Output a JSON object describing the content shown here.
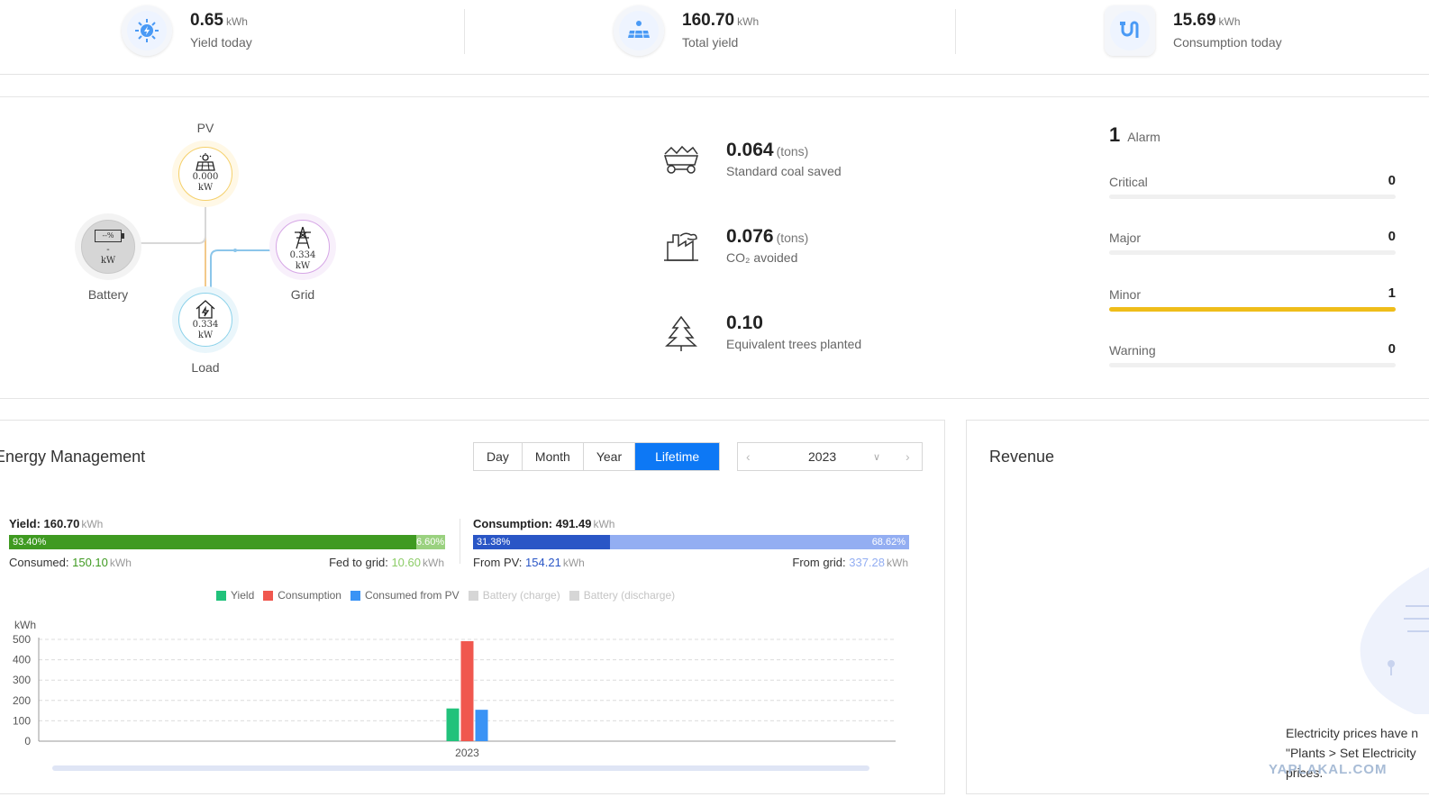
{
  "top_stats": [
    {
      "value": "0.65",
      "unit": "kWh",
      "label": "Yield today",
      "icon": "sun-bolt-icon"
    },
    {
      "value": "160.70",
      "unit": "kWh",
      "label": "Total yield",
      "icon": "solar-panel-icon"
    },
    {
      "value": "15.69",
      "unit": "kWh",
      "label": "Consumption today",
      "icon": "plug-icon"
    }
  ],
  "flow": {
    "pv": {
      "label": "PV",
      "value": "0.000",
      "unit": "kW",
      "icon": "solar-panel-icon"
    },
    "battery": {
      "label": "Battery",
      "soc": "--%",
      "value": "-",
      "unit": "kW",
      "icon": "battery-icon"
    },
    "grid": {
      "label": "Grid",
      "value": "0.334",
      "unit": "kW",
      "icon": "power-tower-icon"
    },
    "load": {
      "label": "Load",
      "value": "0.334",
      "unit": "kW",
      "icon": "house-icon"
    }
  },
  "environment": [
    {
      "value": "0.064",
      "unit": "(tons)",
      "label": "Standard coal saved",
      "icon": "coal-cart-icon"
    },
    {
      "value": "0.076",
      "unit": "(tons)",
      "label": "CO₂ avoided",
      "icon": "factory-icon"
    },
    {
      "value": "0.10",
      "unit": "",
      "label": "Equivalent trees planted",
      "icon": "tree-icon"
    }
  ],
  "alarms": {
    "count": "1",
    "title": "Alarm",
    "rows": [
      {
        "name": "Critical",
        "count": "0",
        "level": 0
      },
      {
        "name": "Major",
        "count": "0",
        "level": 0
      },
      {
        "name": "Minor",
        "count": "1",
        "level": 1
      },
      {
        "name": "Warning",
        "count": "0",
        "level": 0
      }
    ],
    "accent": "#efbd1a"
  },
  "energy": {
    "title": "Energy Management",
    "tabs": [
      "Day",
      "Month",
      "Year",
      "Lifetime"
    ],
    "active_tab": "Lifetime",
    "date": "2023",
    "yield": {
      "label": "Yield:",
      "value": "160.70",
      "unit": "kWh",
      "consumed_pct": "93.40%",
      "fed_pct": "6.60%",
      "consumed_label": "Consumed:",
      "consumed_value": "150.10",
      "fed_label": "Fed to grid:",
      "fed_value": "10.60",
      "unit2": "kWh"
    },
    "consumption": {
      "label": "Consumption:",
      "value": "491.49",
      "unit": "kWh",
      "pv_pct": "31.38%",
      "grid_pct": "68.62%",
      "pv_label": "From PV:",
      "pv_value": "154.21",
      "grid_label": "From grid:",
      "grid_value": "337.28",
      "unit2": "kWh"
    },
    "legend": [
      {
        "name": "Yield",
        "color": "#21c27b",
        "active": true
      },
      {
        "name": "Consumption",
        "color": "#f0574e",
        "active": true
      },
      {
        "name": "Consumed from PV",
        "color": "#3a93f5",
        "active": true
      },
      {
        "name": "Battery (charge)",
        "color": "#d6d6d6",
        "active": false
      },
      {
        "name": "Battery (discharge)",
        "color": "#d6d6d6",
        "active": false
      }
    ]
  },
  "chart_data": {
    "type": "bar",
    "ylabel": "kWh",
    "ylim": [
      0,
      500
    ],
    "yticks": [
      0,
      100,
      200,
      300,
      400,
      500
    ],
    "categories": [
      "2023"
    ],
    "series": [
      {
        "name": "Yield",
        "values": [
          160.7
        ],
        "color": "#21c27b"
      },
      {
        "name": "Consumption",
        "values": [
          491.49
        ],
        "color": "#f0574e"
      },
      {
        "name": "Consumed from PV",
        "values": [
          154.21
        ],
        "color": "#3a93f5"
      }
    ],
    "grid": true
  },
  "revenue": {
    "title": "Revenue",
    "message_line1": "Electricity prices have n",
    "message_line2": "\"Plants > Set Electricity",
    "message_line3": "prices."
  },
  "watermark": "YAPLAKAL.COM"
}
